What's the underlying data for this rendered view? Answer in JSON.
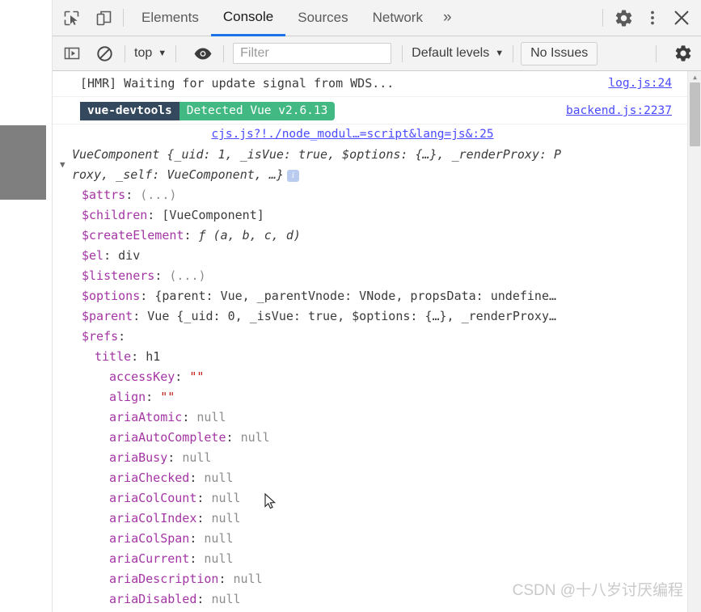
{
  "window": {
    "title": "Chrome DevTools - Console"
  },
  "tabbar": {
    "inspect_icon": "inspect-element-icon",
    "device_icon": "device-toolbar-icon",
    "tabs": [
      {
        "label": "Elements",
        "active": false
      },
      {
        "label": "Console",
        "active": true
      },
      {
        "label": "Sources",
        "active": false
      },
      {
        "label": "Network",
        "active": false
      }
    ],
    "more_label": "»",
    "settings_icon": "gear-icon",
    "more_options_icon": "three-dots-vertical-icon",
    "close_icon": "close-icon"
  },
  "console_toolbar": {
    "execute_icon": "sidebar-toggle-icon",
    "clear_icon": "clear-console-icon",
    "context_label": "top",
    "eye_icon": "live-expression-eye-icon",
    "filter_placeholder": "Filter",
    "filter_value": "",
    "levels_label": "Default levels",
    "issues_label": "No Issues",
    "settings_icon": "gear-icon"
  },
  "messages": [
    {
      "kind": "text",
      "text": "[HMR] Waiting for update signal from WDS...",
      "source": "log.js:24"
    },
    {
      "kind": "badge",
      "badge_dark": "vue-devtools",
      "badge_green": "Detected Vue v2.6.13",
      "source": "backend.js:2237"
    }
  ],
  "object_dump": {
    "source": "cjs.js?!./node_modul…=script&lang=js&:25",
    "header": {
      "arrow": "▼",
      "line1_type": "VueComponent",
      "line1_rest": " {_uid: 1, _isVue: true, $options: {…}, _renderProxy: P",
      "line2": "roxy, _self: VueComponent, …}",
      "info_icon": "info-icon",
      "info_glyph": "i"
    },
    "properties": [
      {
        "indent": 1,
        "tri": "",
        "key": "$attrs",
        "sep": ": ",
        "value": "(...)",
        "vclass": "v-gray"
      },
      {
        "indent": 1,
        "tri": "▶",
        "key": "$children",
        "sep": ": ",
        "value": "[VueComponent]",
        "vclass": "v-dark"
      },
      {
        "indent": 1,
        "tri": "▶",
        "key": "$createElement",
        "sep": ": ",
        "value": "ƒ (a, b, c, d)",
        "vclass": "fn-f"
      },
      {
        "indent": 1,
        "tri": "▶",
        "key": "$el",
        "sep": ": ",
        "value": "div",
        "vclass": "v-dark"
      },
      {
        "indent": 1,
        "tri": "",
        "key": "$listeners",
        "sep": ": ",
        "value": "(...)",
        "vclass": "v-gray"
      },
      {
        "indent": 1,
        "tri": "▶",
        "key": "$options",
        "sep": ": ",
        "value": "{parent: Vue, _parentVnode: VNode, propsData: undefine…",
        "vclass": "v-dark"
      },
      {
        "indent": 1,
        "tri": "▶",
        "key": "$parent",
        "sep": ": ",
        "value": "Vue {_uid: 0, _isVue: true, $options: {…}, _renderProxy…",
        "vclass": "v-dark"
      },
      {
        "indent": 1,
        "tri": "▼",
        "key": "$refs",
        "sep": ":",
        "value": "",
        "vclass": "v-dark"
      },
      {
        "indent": 2,
        "tri": "▼",
        "key": "title",
        "sep": ": ",
        "value": "h1",
        "vclass": "v-dark"
      },
      {
        "indent": 3,
        "tri": "",
        "key": "accessKey",
        "sep": ": ",
        "value": "\"\"",
        "vclass": "v-str"
      },
      {
        "indent": 3,
        "tri": "",
        "key": "align",
        "sep": ": ",
        "value": "\"\"",
        "vclass": "v-str"
      },
      {
        "indent": 3,
        "tri": "",
        "key": "ariaAtomic",
        "sep": ": ",
        "value": "null",
        "vclass": "v-gray"
      },
      {
        "indent": 3,
        "tri": "",
        "key": "ariaAutoComplete",
        "sep": ": ",
        "value": "null",
        "vclass": "v-gray"
      },
      {
        "indent": 3,
        "tri": "",
        "key": "ariaBusy",
        "sep": ": ",
        "value": "null",
        "vclass": "v-gray"
      },
      {
        "indent": 3,
        "tri": "",
        "key": "ariaChecked",
        "sep": ": ",
        "value": "null",
        "vclass": "v-gray"
      },
      {
        "indent": 3,
        "tri": "",
        "key": "ariaColCount",
        "sep": ": ",
        "value": "null",
        "vclass": "v-gray"
      },
      {
        "indent": 3,
        "tri": "",
        "key": "ariaColIndex",
        "sep": ": ",
        "value": "null",
        "vclass": "v-gray"
      },
      {
        "indent": 3,
        "tri": "",
        "key": "ariaColSpan",
        "sep": ": ",
        "value": "null",
        "vclass": "v-gray"
      },
      {
        "indent": 3,
        "tri": "",
        "key": "ariaCurrent",
        "sep": ": ",
        "value": "null",
        "vclass": "v-gray"
      },
      {
        "indent": 3,
        "tri": "",
        "key": "ariaDescription",
        "sep": ": ",
        "value": "null",
        "vclass": "v-gray"
      },
      {
        "indent": 3,
        "tri": "",
        "key": "ariaDisabled",
        "sep": ": ",
        "value": "null",
        "vclass": "v-gray"
      }
    ]
  },
  "scrollbar": {
    "up_arrow": "▲"
  },
  "watermark": {
    "text": "CSDN @十八岁讨厌编程"
  },
  "colors": {
    "accent_blue": "#1a73e8",
    "vue_dark": "#35495e",
    "vue_green": "#42b883",
    "key_magenta": "#a435a4",
    "link_blue": "#4a4aff",
    "string_red": "#c41a16",
    "null_gray": "#8c8c8c"
  }
}
